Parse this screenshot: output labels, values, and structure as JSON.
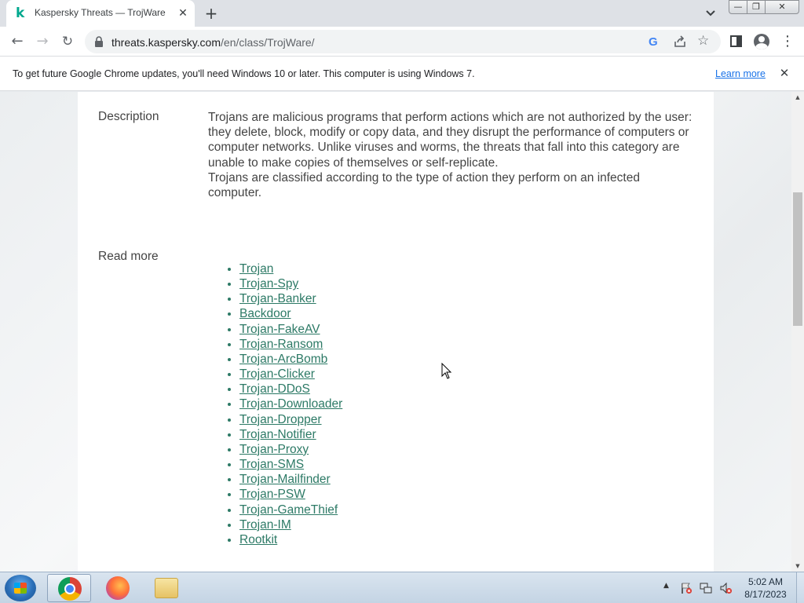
{
  "tab": {
    "favicon": "k",
    "title": "Kaspersky Threats — TrojWare",
    "close": "✕"
  },
  "new_tab": "+",
  "window": {
    "minimize": "—",
    "maximize": "❐",
    "close": "✕"
  },
  "toolbar": {
    "back": "←",
    "forward": "→",
    "reload": "↻",
    "url_host": "threats.kaspersky.com",
    "url_path": "/en/class/TrojWare/",
    "google_badge": "G",
    "star": "☆",
    "menu": "⋮"
  },
  "infobar": {
    "text": "To get future Google Chrome updates, you'll need Windows 10 or later. This computer is using Windows 7.",
    "link": "Learn more",
    "close": "✕"
  },
  "page": {
    "description_label": "Description",
    "description_p1": "Trojans are malicious programs that perform actions which are not authorized by the user: they delete, block, modify or copy data, and they disrupt the performance of computers or computer networks. Unlike viruses and worms, the threats that fall into this category are unable to make copies of themselves or self-replicate.",
    "description_p2": "Trojans are classified according to the type of action they perform on an infected computer.",
    "read_more_label": "Read more",
    "links": [
      "Trojan",
      "Trojan-Spy",
      "Trojan-Banker",
      "Backdoor",
      "Trojan-FakeAV",
      "Trojan-Ransom",
      "Trojan-ArcBomb",
      "Trojan-Clicker",
      "Trojan-DDoS",
      "Trojan-Downloader",
      "Trojan-Dropper",
      "Trojan-Notifier",
      "Trojan-Proxy",
      "Trojan-SMS",
      "Trojan-Mailfinder",
      "Trojan-PSW",
      "Trojan-GameThief",
      "Trojan-IM",
      "Rootkit"
    ]
  },
  "scrollbar": {
    "up": "▲",
    "down": "▼"
  },
  "taskbar": {
    "tray_arrow": "▲",
    "time": "5:02 AM",
    "date": "8/17/2023"
  },
  "colors": {
    "link": "#2d7a66",
    "infobar_link": "#1a73e8",
    "brand": "#00a88e"
  }
}
